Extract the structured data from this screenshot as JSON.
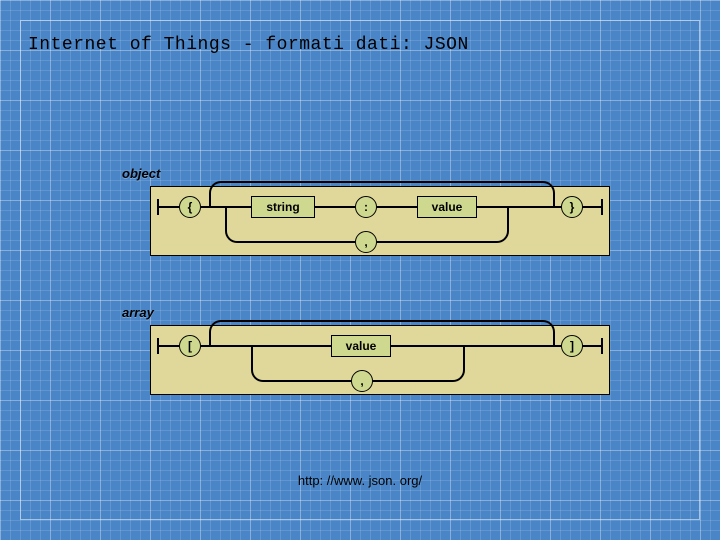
{
  "title": "Internet of Things - formati dati: JSON",
  "footer": "http: //www. json. org/",
  "diagrams": {
    "object": {
      "label": "object",
      "open": "{",
      "close": "}",
      "string": "string",
      "colon": ":",
      "value": "value",
      "comma": ","
    },
    "array": {
      "label": "array",
      "open": "[",
      "close": "]",
      "value": "value",
      "comma": ","
    }
  }
}
